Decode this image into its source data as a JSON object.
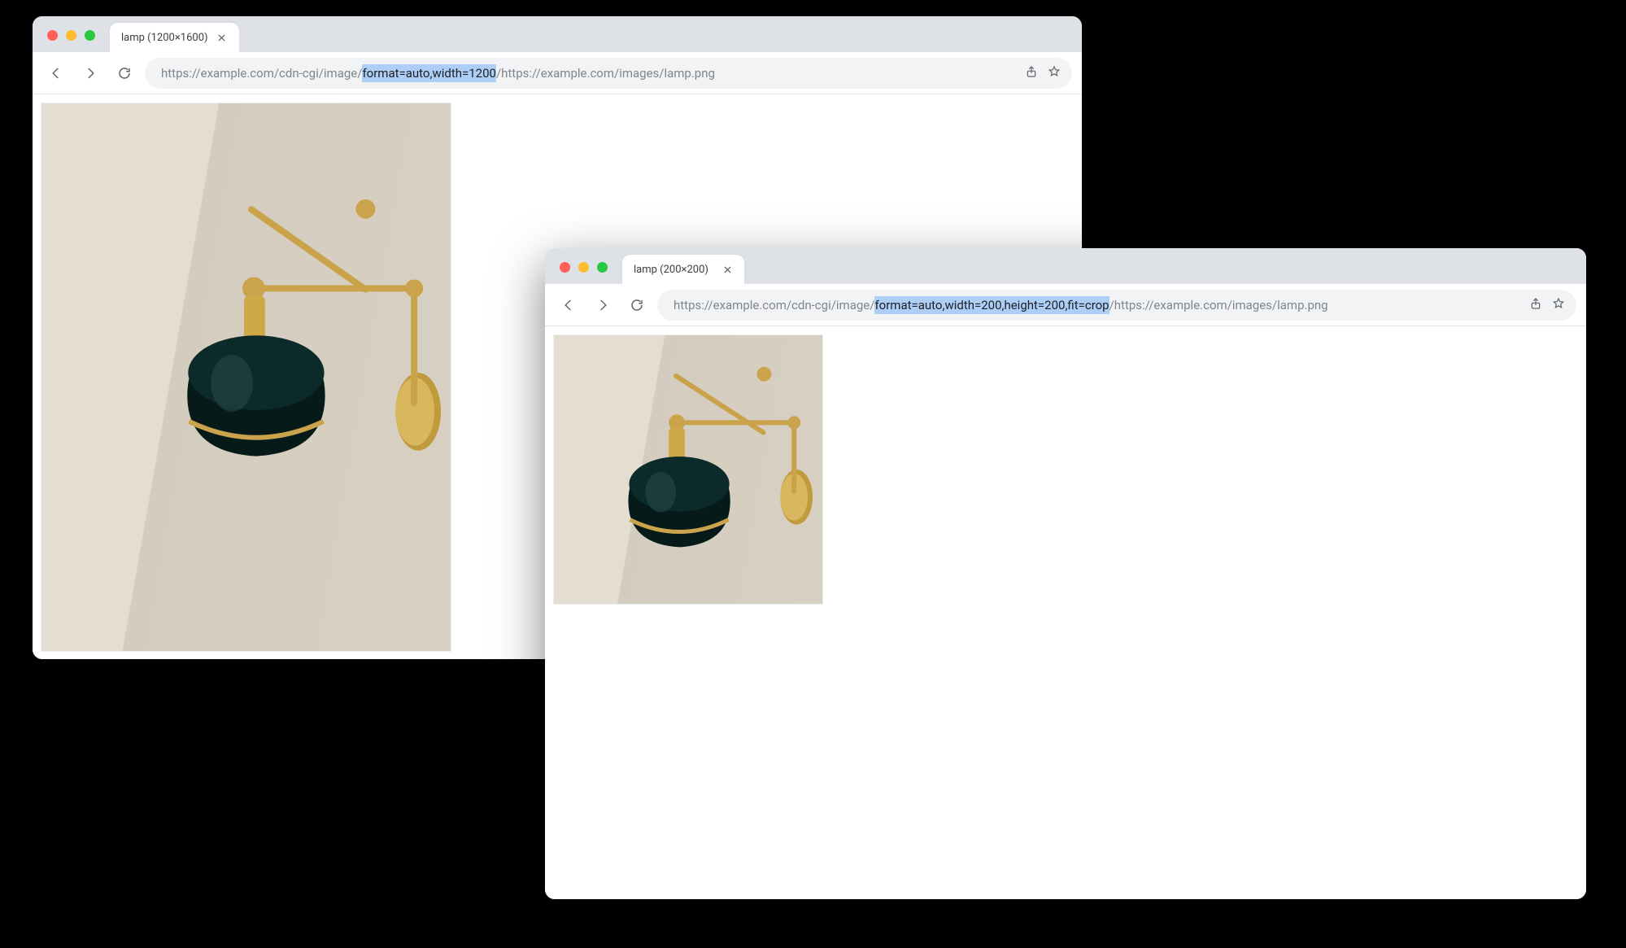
{
  "windows": {
    "back": {
      "tab_title": "lamp (1200×1600)",
      "url": {
        "prefix": "https://example.com/cdn-cgi/image/",
        "highlight": "format=auto,width=1200",
        "suffix": "/https://example.com/images/lamp.png"
      },
      "image_alt": "lamp 1200x1600"
    },
    "front": {
      "tab_title": "lamp (200×200)",
      "url": {
        "prefix": "https://example.com/cdn-cgi/image/",
        "highlight": "format=auto,width=200,height=200,fit=crop",
        "suffix": "/https://example.com/images/lamp.png"
      },
      "image_alt": "lamp 200x200"
    }
  }
}
